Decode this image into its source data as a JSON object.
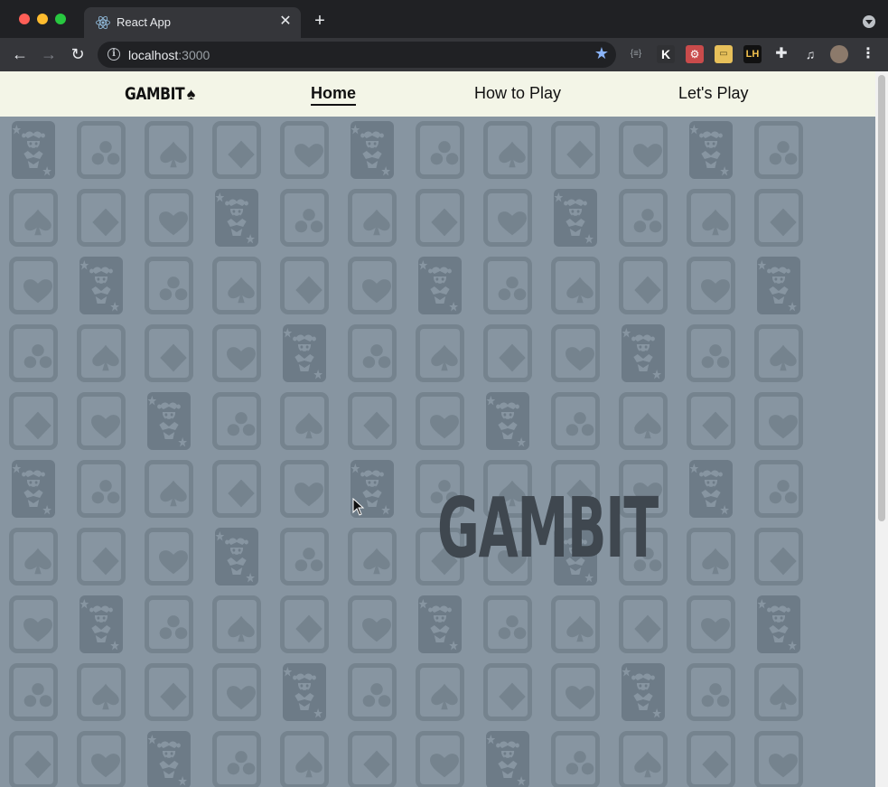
{
  "browser": {
    "tab": {
      "title": "React App",
      "favicon": "react-icon"
    },
    "url": {
      "host": "localhost",
      "port": ":3000"
    },
    "extensions": [
      "json-viewer-icon",
      "k-extension-icon",
      "react-devtools-icon",
      "notes-extension-icon",
      "lighthouse-icon",
      "puzzle-extensions-icon",
      "media-control-icon",
      "profile-avatar"
    ],
    "colors": {
      "tabstrip": "#202124",
      "toolbar": "#35363a",
      "omnibox": "#202124"
    }
  },
  "navbar": {
    "brand": "GAMBIT",
    "brand_icon": "spade-icon",
    "links": [
      {
        "label": "Home",
        "active": true
      },
      {
        "label": "How to Play",
        "active": false
      },
      {
        "label": "Let's Play",
        "active": false
      }
    ],
    "background": "#f3f5e7"
  },
  "hero": {
    "title": "GAMBIT",
    "color": "#3f474f"
  },
  "background": {
    "color": "#8795a1",
    "card_outline": "#75838e",
    "pattern": [
      "joker",
      "clubs",
      "spades",
      "diamonds",
      "hearts"
    ]
  }
}
